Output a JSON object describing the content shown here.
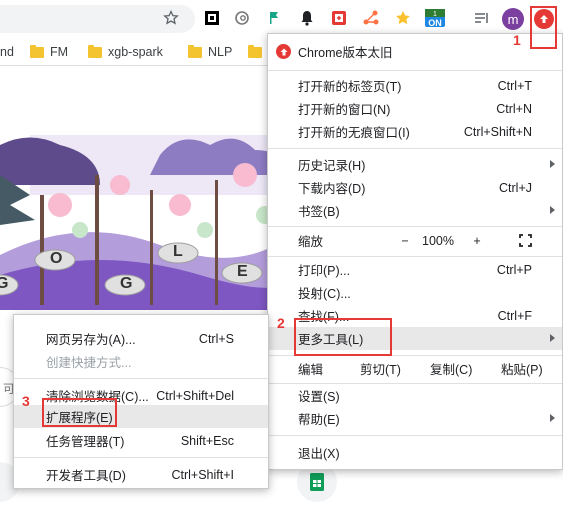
{
  "toolbar": {
    "star_icon": "star-outline-icon",
    "extensions": [
      "qr-code-icon",
      "web-scraper-icon",
      "flag-icon",
      "bell-icon",
      "red-ext-icon",
      "connection-icon",
      "star-ext-icon",
      "on-badge-icon",
      "reading-list-icon"
    ],
    "on_badge": "ON",
    "profile_initial": "m",
    "update_badge_color": "#e53935"
  },
  "bookmarks": [
    {
      "label": "nd",
      "has_folder": false
    },
    {
      "label": "FM",
      "has_folder": true
    },
    {
      "label": "xgb-spark",
      "has_folder": true
    },
    {
      "label": "NLP",
      "has_folder": true
    },
    {
      "label": "",
      "has_folder": true
    }
  ],
  "page": {
    "doodle_letters": [
      "G",
      "L",
      "E",
      "O",
      "G"
    ],
    "search_hint": "可"
  },
  "main_menu": {
    "update_item": "Chrome版本太旧",
    "items": [
      {
        "label": "打开新的标签页(T)",
        "shortcut": "Ctrl+T"
      },
      {
        "label": "打开新的窗口(N)",
        "shortcut": "Ctrl+N"
      },
      {
        "label": "打开新的无痕窗口(I)",
        "shortcut": "Ctrl+Shift+N"
      },
      {
        "label": "历史记录(H)",
        "shortcut": ""
      },
      {
        "label": "下载内容(D)",
        "shortcut": "Ctrl+J"
      },
      {
        "label": "书签(B)",
        "shortcut": ""
      },
      {
        "label": "打印(P)...",
        "shortcut": "Ctrl+P"
      },
      {
        "label": "投射(C)...",
        "shortcut": ""
      },
      {
        "label": "查找(F)...",
        "shortcut": "Ctrl+F"
      },
      {
        "label": "更多工具(L)",
        "shortcut": ""
      },
      {
        "label": "设置(S)",
        "shortcut": ""
      },
      {
        "label": "帮助(E)",
        "shortcut": ""
      },
      {
        "label": "退出(X)",
        "shortcut": ""
      }
    ],
    "zoom": {
      "label": "缩放",
      "minus": "−",
      "value": "100%",
      "plus": "+"
    },
    "edit": {
      "label": "编辑",
      "cut": "剪切(T)",
      "copy": "复制(C)",
      "paste": "粘贴(P)"
    }
  },
  "sub_menu": {
    "items": [
      {
        "label": "网页另存为(A)...",
        "shortcut": "Ctrl+S"
      },
      {
        "label": "创建快捷方式...",
        "shortcut": "",
        "disabled": true
      },
      {
        "label": "清除浏览数据(C)...",
        "shortcut": "Ctrl+Shift+Del"
      },
      {
        "label": "扩展程序(E)",
        "shortcut": ""
      },
      {
        "label": "任务管理器(T)",
        "shortcut": "Shift+Esc"
      },
      {
        "label": "开发者工具(D)",
        "shortcut": "Ctrl+Shift+I"
      }
    ]
  },
  "annotations": {
    "step1": "1",
    "step2": "2",
    "step3": "3",
    "color": "#e53935"
  }
}
